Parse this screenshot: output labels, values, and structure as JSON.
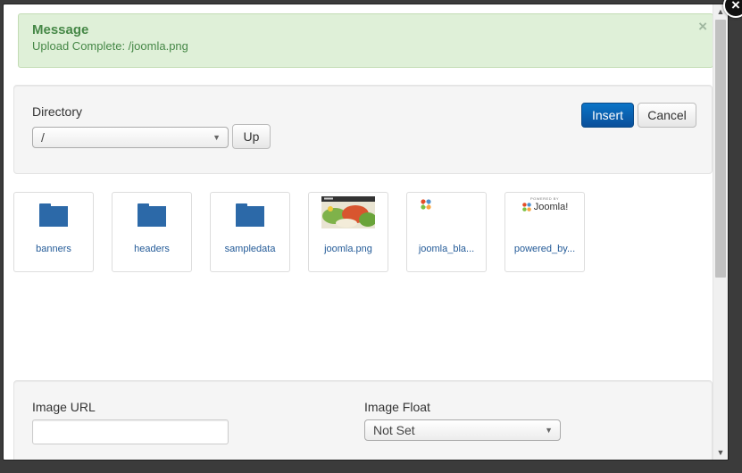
{
  "alert": {
    "heading": "Message",
    "text": "Upload Complete: /joomla.png",
    "close_glyph": "×"
  },
  "directory": {
    "label": "Directory",
    "selected": "/",
    "up_label": "Up"
  },
  "actions": {
    "insert_label": "Insert",
    "cancel_label": "Cancel"
  },
  "files": [
    {
      "label": "banners",
      "type": "folder"
    },
    {
      "label": "headers",
      "type": "folder"
    },
    {
      "label": "sampledata",
      "type": "folder"
    },
    {
      "label": "joomla.png",
      "type": "image"
    },
    {
      "label": "joomla_bla...",
      "type": "image"
    },
    {
      "label": "powered_by...",
      "type": "image"
    }
  ],
  "image_url": {
    "label": "Image URL",
    "value": ""
  },
  "image_float": {
    "label": "Image Float",
    "selected": "Not Set"
  },
  "thumb_logo_text": "Joomla!",
  "thumb_powered_text": "POWERED BY",
  "colors": {
    "alert_bg": "#dff0d8",
    "alert_text": "#468847",
    "primary": "#0a5fae",
    "folder": "#2c69a8",
    "link": "#245b98"
  }
}
